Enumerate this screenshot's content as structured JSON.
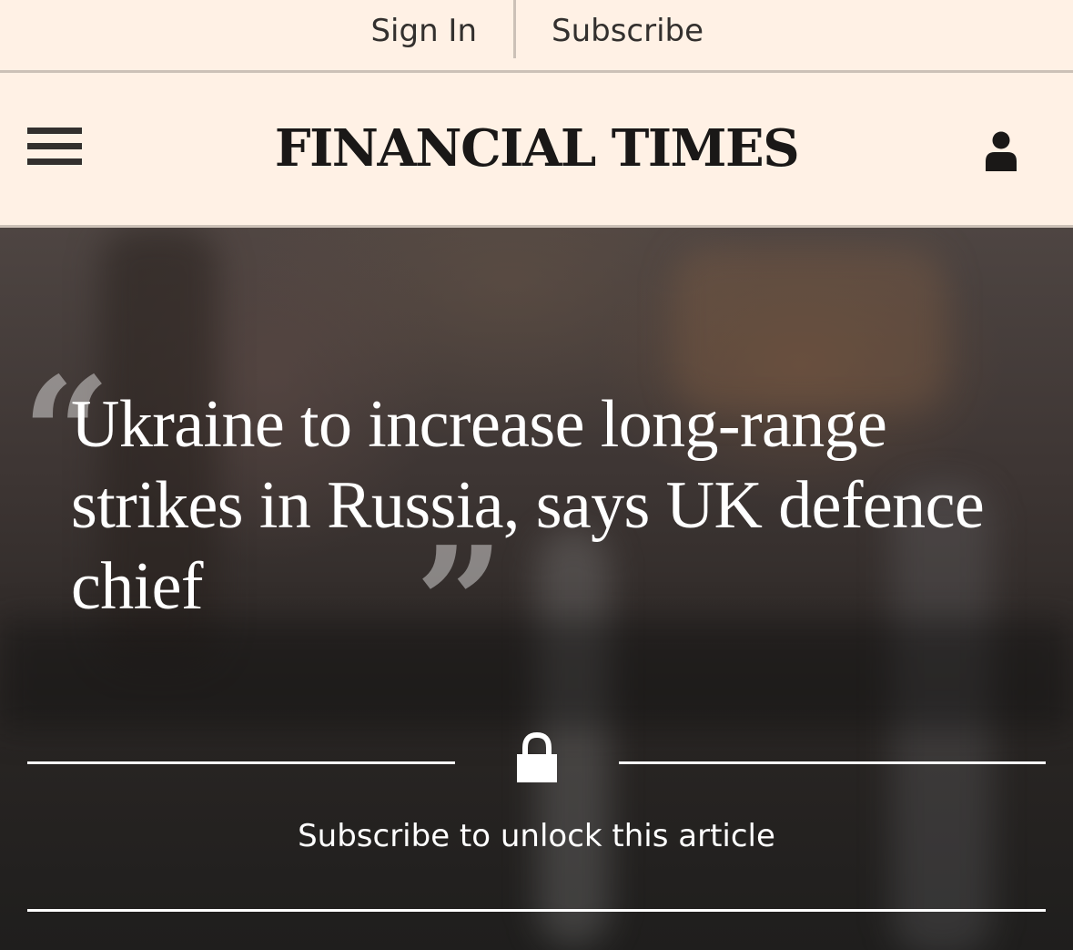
{
  "account_bar": {
    "sign_in_label": "Sign In",
    "subscribe_label": "Subscribe"
  },
  "header": {
    "logo_text": "FINANCIAL TIMES",
    "menu_icon": "hamburger-menu-icon",
    "user_icon": "user-icon"
  },
  "article": {
    "headline": "Ukraine to increase long-range strikes in Russia, says UK defence chief",
    "quote_open": "“",
    "quote_close": "”"
  },
  "barrier": {
    "lock_icon": "lock-icon",
    "message": "Subscribe to unlock this article"
  },
  "colors": {
    "paper": "#fff1e5",
    "ink": "#33302e",
    "divider": "#ccc1b7",
    "overlay_text": "#ffffff"
  }
}
